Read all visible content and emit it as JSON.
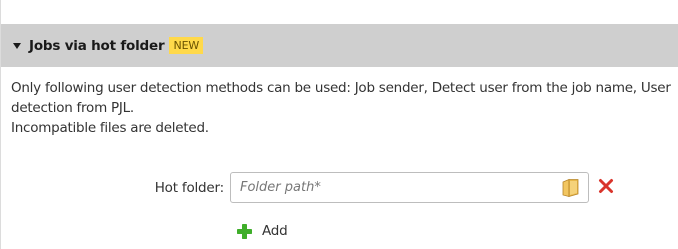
{
  "section": {
    "title": "Jobs via hot folder",
    "badge": "NEW",
    "expanded": true
  },
  "description": {
    "line1": "Only following user detection methods can be used: Job sender, Detect user from the job name, User detection from PJL.",
    "line2": "Incompatible files are deleted."
  },
  "hot_folder": {
    "label": "Hot folder:",
    "value": "",
    "placeholder": "Folder path*",
    "browse_icon": "folder-icon",
    "remove_icon": "red-x-icon"
  },
  "add": {
    "label": "Add",
    "icon": "green-plus-icon"
  },
  "colors": {
    "header_bg": "#cfcfcf",
    "badge_bg": "#ffd94a",
    "remove": "#d9342b",
    "add": "#3fae2a",
    "folder": "#e8b84a"
  }
}
